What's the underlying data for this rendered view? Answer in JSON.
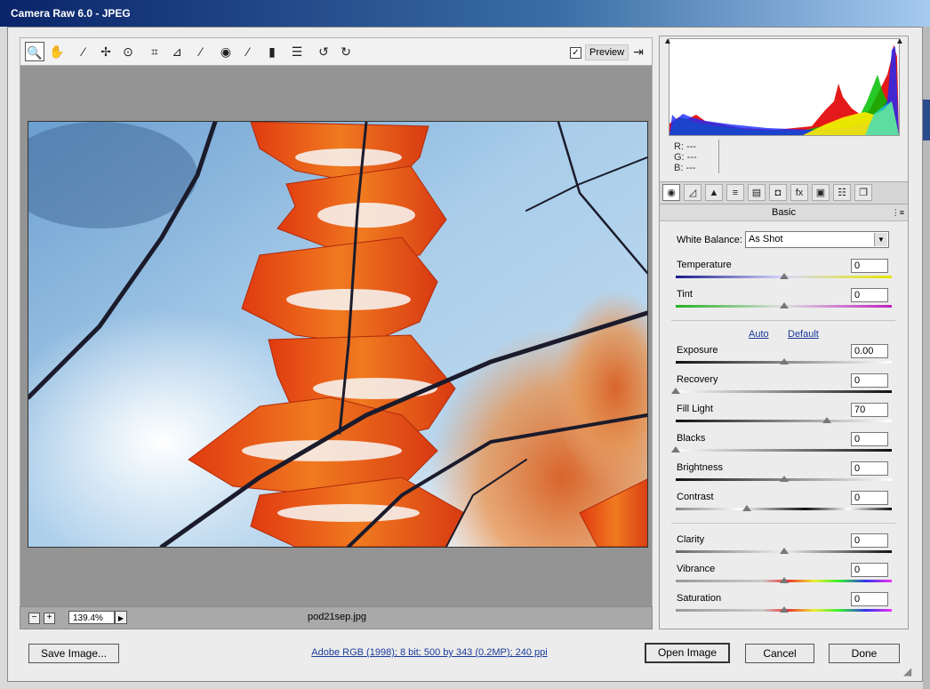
{
  "window": {
    "title": "Camera Raw 6.0  -  JPEG"
  },
  "toolbar": {
    "tools": [
      {
        "icon": "zoom-tool-icon",
        "glyph": "🔍"
      },
      {
        "icon": "hand-tool-icon",
        "glyph": "✋"
      },
      {
        "icon": "white-balance-tool-icon",
        "glyph": "⁄"
      },
      {
        "icon": "color-sampler-tool-icon",
        "glyph": "✢"
      },
      {
        "icon": "targeted-adjustment-tool-icon",
        "glyph": "⊙"
      },
      {
        "icon": "crop-tool-icon",
        "glyph": "⌗"
      },
      {
        "icon": "straighten-tool-icon",
        "glyph": "⊿"
      },
      {
        "icon": "spot-removal-tool-icon",
        "glyph": "⁄"
      },
      {
        "icon": "red-eye-removal-icon",
        "glyph": "◉"
      },
      {
        "icon": "adjustment-brush-icon",
        "glyph": "⁄"
      },
      {
        "icon": "graduated-filter-icon",
        "glyph": "▮"
      },
      {
        "icon": "preferences-icon",
        "glyph": "☰"
      },
      {
        "icon": "rotate-ccw-icon",
        "glyph": "↺"
      },
      {
        "icon": "rotate-cw-icon",
        "glyph": "↻"
      }
    ],
    "preview_label": "Preview",
    "preview_checked": "✓",
    "fullscreen_glyph": "⇥"
  },
  "status": {
    "zoom_minus": "−",
    "zoom_plus": "+",
    "zoom_value": "139.4%",
    "zoom_drop": "▶",
    "filename": "pod21sep.jpg"
  },
  "readout": {
    "r": "R:   ---",
    "g": "G:   ---",
    "b": "B:   ---"
  },
  "panel": {
    "tabs": [
      {
        "icon": "basic-tab-icon",
        "glyph": "◉"
      },
      {
        "icon": "tone-curve-tab-icon",
        "glyph": "◿"
      },
      {
        "icon": "detail-tab-icon",
        "glyph": "▲"
      },
      {
        "icon": "hsl-tab-icon",
        "glyph": "≡"
      },
      {
        "icon": "split-toning-tab-icon",
        "glyph": "▤"
      },
      {
        "icon": "lens-corrections-tab-icon",
        "glyph": "◘"
      },
      {
        "icon": "effects-tab-icon",
        "glyph": "fx"
      },
      {
        "icon": "camera-calibration-tab-icon",
        "glyph": "▣"
      },
      {
        "icon": "presets-tab-icon",
        "glyph": "☷"
      },
      {
        "icon": "snapshots-tab-icon",
        "glyph": "❐"
      }
    ],
    "title": "Basic",
    "menu_glyph": "⋮≡",
    "white_balance_label": "White Balance:",
    "white_balance_value": "As Shot",
    "auto_label": "Auto",
    "default_label": "Default"
  },
  "sliders": [
    {
      "id": "temperature",
      "label": "Temperature",
      "value": "0",
      "pos": 0.5,
      "gradient": "linear-gradient(to right,#1a1a8a,#d8d8ff 50%,#e6e600)"
    },
    {
      "id": "tint",
      "label": "Tint",
      "value": "0",
      "pos": 0.5,
      "gradient": "linear-gradient(to right,#22b022,#e0e0e0 50%,#c020c0)"
    },
    {
      "id": "exposure",
      "label": "Exposure",
      "value": "0.00",
      "pos": 0.5,
      "gradient": "linear-gradient(to right,#111,#fff)"
    },
    {
      "id": "recovery",
      "label": "Recovery",
      "value": "0",
      "pos": 0.0,
      "gradient": "linear-gradient(to right,#fff,#111)"
    },
    {
      "id": "fill-light",
      "label": "Fill Light",
      "value": "70",
      "pos": 0.7,
      "gradient": "linear-gradient(to right,#111,#fff)"
    },
    {
      "id": "blacks",
      "label": "Blacks",
      "value": "0",
      "pos": 0.0,
      "gradient": "linear-gradient(to right,#fff,#111)"
    },
    {
      "id": "brightness",
      "label": "Brightness",
      "value": "0",
      "pos": 0.5,
      "gradient": "linear-gradient(to right,#111,#fff)"
    },
    {
      "id": "contrast",
      "label": "Contrast",
      "value": "0",
      "pos": 0.33,
      "gradient": "linear-gradient(to right,#888,#fff 30%,#111 60%,#fff 80%,#111)"
    },
    {
      "id": "clarity",
      "label": "Clarity",
      "value": "0",
      "pos": 0.5,
      "gradient": "linear-gradient(to right,#666,#eee 50%,#111)"
    },
    {
      "id": "vibrance",
      "label": "Vibrance",
      "value": "0",
      "pos": 0.5,
      "gradient": "linear-gradient(to right,#999,#ccc 40%,#e33,#ee3,#3e3,#33e,#e3e)"
    },
    {
      "id": "saturation",
      "label": "Saturation",
      "value": "0",
      "pos": 0.5,
      "gradient": "linear-gradient(to right,#999,#ccc 40%,#e33,#ee3,#3e3,#33e,#e3e)"
    }
  ],
  "footer": {
    "save_label": "Save Image...",
    "info_link": "Adobe RGB (1998); 8 bit; 500 by 343 (0.2MP); 240 ppi",
    "open_label": "Open Image",
    "cancel_label": "Cancel",
    "done_label": "Done"
  }
}
